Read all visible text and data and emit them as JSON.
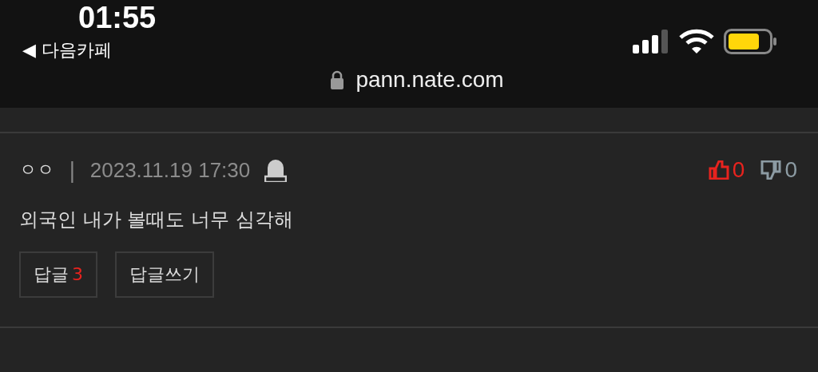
{
  "status_bar": {
    "time": "01:55",
    "back_label": "◀ 다음카페",
    "url": "pann.nate.com"
  },
  "comment": {
    "author": "ㅇㅇ",
    "separator": "|",
    "date": "2023.11.19 17:30",
    "likes": "0",
    "dislikes": "0",
    "text": "외국인 내가 볼때도 너무 심각해",
    "reply_label": "답글",
    "reply_count": "3",
    "write_reply": "답글쓰기"
  }
}
